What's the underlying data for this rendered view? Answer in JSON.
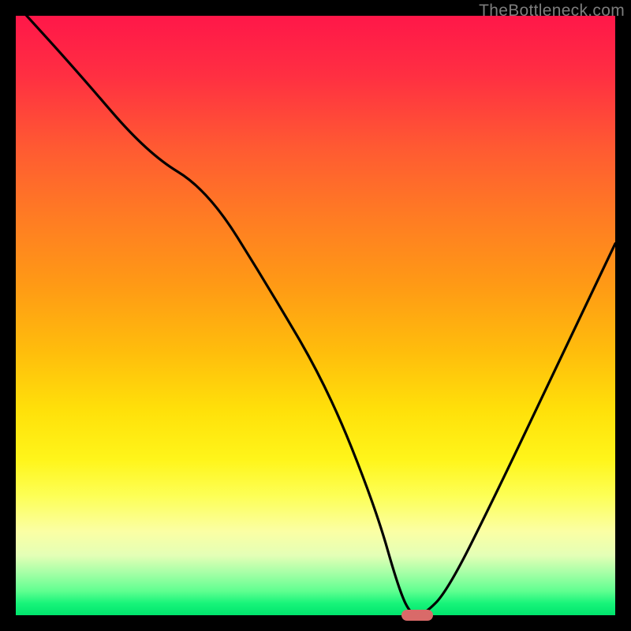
{
  "watermark": "TheBottleneck.com",
  "chart_data": {
    "type": "line",
    "title": "",
    "xlabel": "",
    "ylabel": "",
    "xlim": [
      0,
      100
    ],
    "ylim": [
      0,
      100
    ],
    "grid": false,
    "series": [
      {
        "name": "curve",
        "x": [
          0,
          10,
          22,
          32,
          42,
          52,
          60,
          64,
          66,
          68,
          72,
          80,
          90,
          100
        ],
        "values": [
          102,
          91,
          77,
          71,
          55,
          38,
          18,
          4,
          0,
          0,
          4,
          20,
          41,
          62
        ]
      }
    ],
    "marker": {
      "x": 67,
      "y": 0,
      "color": "#d96a69"
    },
    "background_gradient": {
      "direction": "vertical",
      "stops": [
        {
          "pos": 0,
          "color": "#ff1749"
        },
        {
          "pos": 50,
          "color": "#ffbd0c"
        },
        {
          "pos": 80,
          "color": "#fdff55"
        },
        {
          "pos": 100,
          "color": "#00e46c"
        }
      ]
    }
  }
}
